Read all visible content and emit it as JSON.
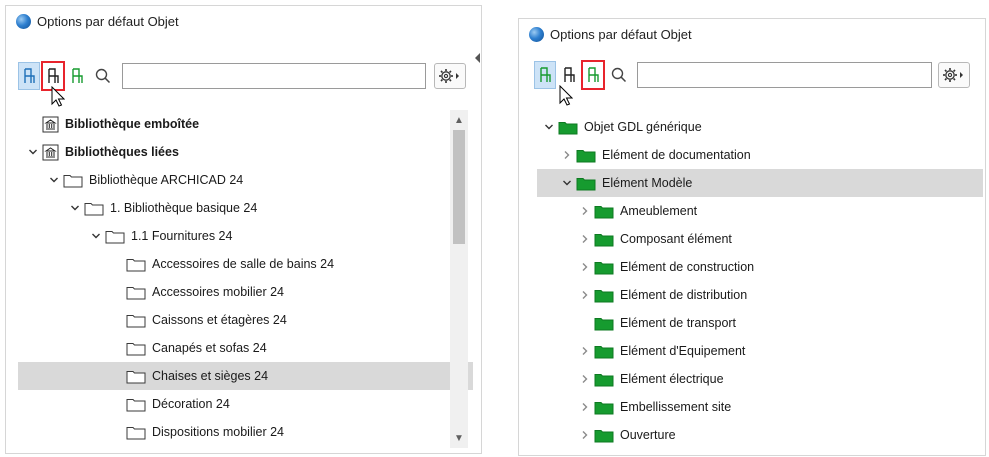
{
  "colors": {
    "accent_red": "#e8242c",
    "folder_green": "#169b2f",
    "selected_row": "#d9d9d9"
  },
  "left_panel": {
    "title": "Options par défaut Objet",
    "search": {
      "value": "",
      "placeholder": ""
    },
    "toolbar_icons": [
      "library-view-icon",
      "folder-view-icon",
      "subtype-view-icon",
      "search-icon",
      "settings-gear-icon"
    ],
    "tree": [
      {
        "label": "Bibliothèque emboîtée",
        "level": 0,
        "expander": "none",
        "icon": "library",
        "bold": true,
        "selected": false
      },
      {
        "label": "Bibliothèques liées",
        "level": 0,
        "expander": "expanded",
        "icon": "library",
        "bold": true,
        "selected": false
      },
      {
        "label": "Bibliothèque ARCHICAD 24",
        "level": 1,
        "expander": "expanded",
        "icon": "folder",
        "bold": false,
        "selected": false
      },
      {
        "label": "1. Bibliothèque basique 24",
        "level": 2,
        "expander": "expanded",
        "icon": "folder",
        "bold": false,
        "selected": false
      },
      {
        "label": "1.1 Fournitures 24",
        "level": 3,
        "expander": "expanded",
        "icon": "folder",
        "bold": false,
        "selected": false
      },
      {
        "label": "Accessoires de salle de bains 24",
        "level": 4,
        "expander": "none",
        "icon": "folder",
        "bold": false,
        "selected": false
      },
      {
        "label": "Accessoires mobilier 24",
        "level": 4,
        "expander": "none",
        "icon": "folder",
        "bold": false,
        "selected": false
      },
      {
        "label": "Caissons et étagères 24",
        "level": 4,
        "expander": "none",
        "icon": "folder",
        "bold": false,
        "selected": false
      },
      {
        "label": "Canapés et sofas 24",
        "level": 4,
        "expander": "none",
        "icon": "folder",
        "bold": false,
        "selected": false
      },
      {
        "label": "Chaises et sièges 24",
        "level": 4,
        "expander": "none",
        "icon": "folder",
        "bold": false,
        "selected": true
      },
      {
        "label": "Décoration 24",
        "level": 4,
        "expander": "none",
        "icon": "folder",
        "bold": false,
        "selected": false
      },
      {
        "label": "Dispositions mobilier 24",
        "level": 4,
        "expander": "none",
        "icon": "folder",
        "bold": false,
        "selected": false
      }
    ]
  },
  "right_panel": {
    "title": "Options par défaut Objet",
    "search": {
      "value": "",
      "placeholder": ""
    },
    "toolbar_icons": [
      "library-view-icon",
      "folder-view-icon",
      "subtype-view-icon",
      "search-icon",
      "settings-gear-icon"
    ],
    "tree": [
      {
        "label": "Objet GDL générique",
        "level": 0,
        "expander": "expanded",
        "icon": "green-folder",
        "bold": false,
        "selected": false
      },
      {
        "label": "Elément de documentation",
        "level": 1,
        "expander": "collapsed",
        "icon": "green-folder",
        "bold": false,
        "selected": false
      },
      {
        "label": "Elément Modèle",
        "level": 1,
        "expander": "expanded",
        "icon": "green-folder",
        "bold": false,
        "selected": true
      },
      {
        "label": "Ameublement",
        "level": 2,
        "expander": "collapsed",
        "icon": "green-folder",
        "bold": false,
        "selected": false
      },
      {
        "label": "Composant élément",
        "level": 2,
        "expander": "collapsed",
        "icon": "green-folder",
        "bold": false,
        "selected": false
      },
      {
        "label": "Elément de construction",
        "level": 2,
        "expander": "collapsed",
        "icon": "green-folder",
        "bold": false,
        "selected": false
      },
      {
        "label": "Elément de distribution",
        "level": 2,
        "expander": "collapsed",
        "icon": "green-folder",
        "bold": false,
        "selected": false
      },
      {
        "label": "Elément de transport",
        "level": 2,
        "expander": "none",
        "icon": "green-folder",
        "bold": false,
        "selected": false
      },
      {
        "label": "Elément d'Equipement",
        "level": 2,
        "expander": "collapsed",
        "icon": "green-folder",
        "bold": false,
        "selected": false
      },
      {
        "label": "Elément électrique",
        "level": 2,
        "expander": "collapsed",
        "icon": "green-folder",
        "bold": false,
        "selected": false
      },
      {
        "label": "Embellissement site",
        "level": 2,
        "expander": "collapsed",
        "icon": "green-folder",
        "bold": false,
        "selected": false
      },
      {
        "label": "Ouverture",
        "level": 2,
        "expander": "collapsed",
        "icon": "green-folder",
        "bold": false,
        "selected": false
      }
    ]
  }
}
